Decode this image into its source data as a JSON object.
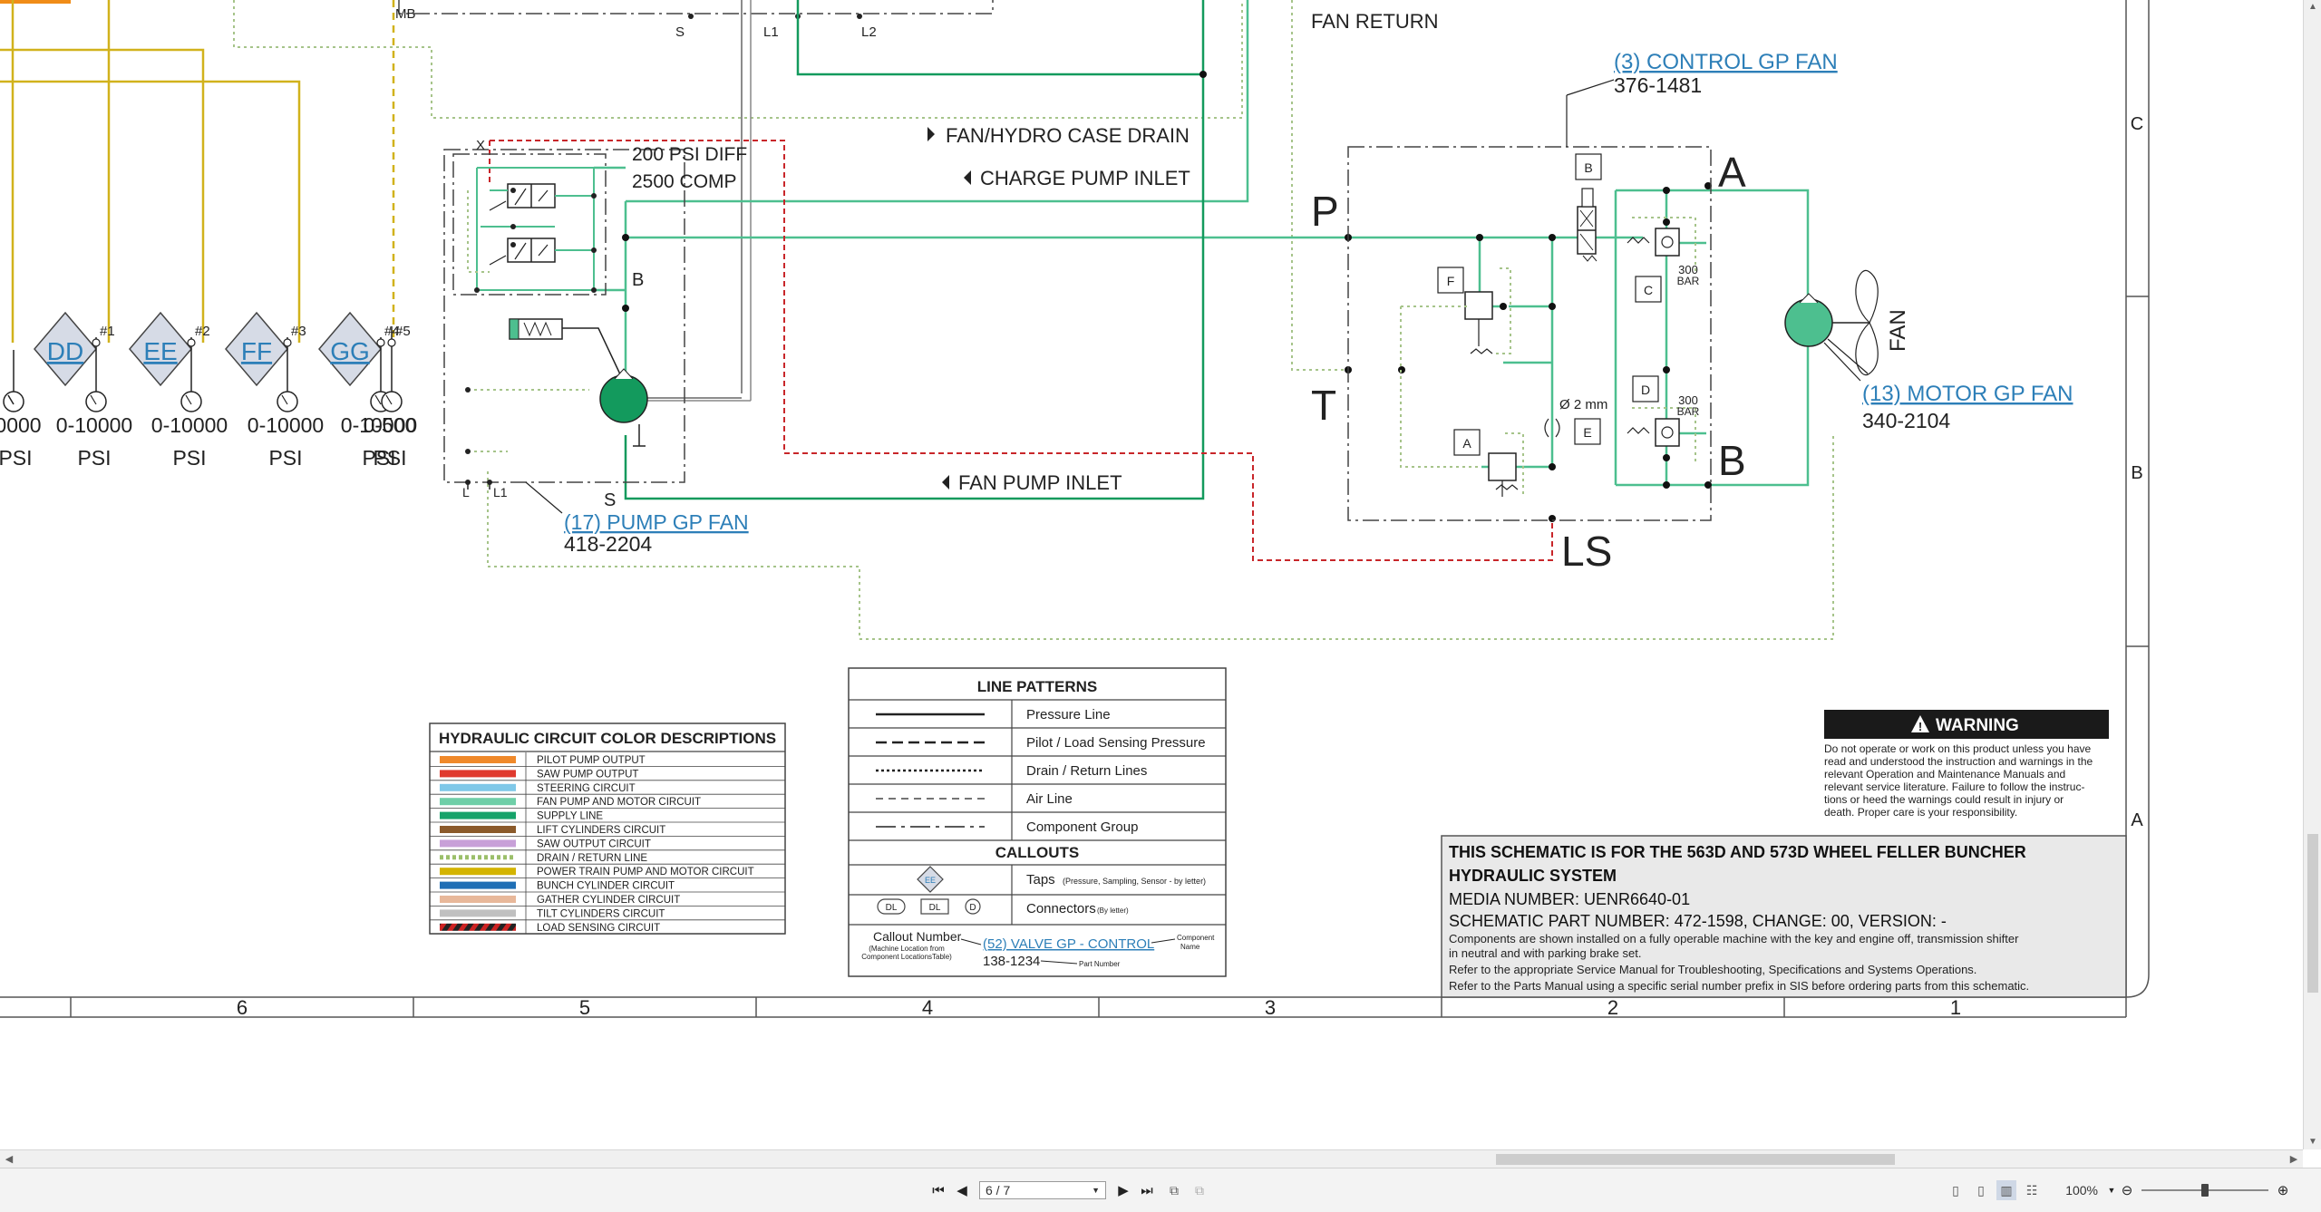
{
  "schematic": {
    "labels": {
      "mb": "MB",
      "s_top": "S",
      "l1_top": "L1",
      "l2_top": "L2",
      "fan_return": "FAN RETURN",
      "control_gp_fan": "(3) CONTROL GP FAN",
      "control_pn": "376-1481",
      "fan_hydro_case_drain": "FAN/HYDRO CASE DRAIN",
      "charge_pump_inlet": "CHARGE PUMP INLET",
      "fan_pump_inlet": "FAN PUMP INLET",
      "psi_diff": "200 PSI DIFF",
      "comp": "2500 COMP",
      "port_x": "X",
      "port_b_pump": "B",
      "port_s_pump": "S",
      "port_l": "L",
      "port_l1": "L1",
      "pump_gp_fan": "(17) PUMP GP FAN",
      "pump_pn": "418-2204",
      "port_p": "P",
      "port_t": "T",
      "port_a": "A",
      "port_b": "B",
      "port_ls": "LS",
      "box_b": "B",
      "box_c": "C",
      "box_d": "D",
      "box_e": "E",
      "box_f": "F",
      "box_a": "A",
      "bar_300_a": "300",
      "bar_label_a": "BAR",
      "bar_300_b": "300",
      "bar_label_b": "BAR",
      "orifice": "Ø 2 mm",
      "fan": "FAN",
      "motor_gp_fan": "(13) MOTOR GP FAN",
      "motor_pn": "340-2104",
      "grid_c": "C",
      "grid_b": "B",
      "grid_a": "A"
    },
    "taps": [
      {
        "id": "DD",
        "num": "#1",
        "range": "0-10000",
        "unit": "PSI"
      },
      {
        "id": "EE",
        "num": "#2",
        "range": "0-10000",
        "unit": "PSI"
      },
      {
        "id": "FF",
        "num": "#3",
        "range": "0-10000",
        "unit": "PSI"
      },
      {
        "id": "GG",
        "num": "#4",
        "range": "0-10000",
        "unit": "PSI"
      },
      {
        "id": "",
        "num": "#5",
        "range": "0-500",
        "unit": "PSI"
      }
    ],
    "partial_tap": {
      "range": "0000",
      "unit": "PSI"
    },
    "grid_numbers": [
      "6",
      "5",
      "4",
      "3",
      "2",
      "1"
    ],
    "color_legend": {
      "title": "HYDRAULIC CIRCUIT COLOR DESCRIPTIONS",
      "items": [
        {
          "label": "PILOT PUMP OUTPUT",
          "color": "#f0892a"
        },
        {
          "label": "SAW PUMP OUTPUT",
          "color": "#e03a2e"
        },
        {
          "label": "STEERING CIRCUIT",
          "color": "#7fc8e8"
        },
        {
          "label": "FAN PUMP AND MOTOR CIRCUIT",
          "color": "#6fcfa8"
        },
        {
          "label": "SUPPLY LINE",
          "color": "#16a36a"
        },
        {
          "label": "LIFT CYLINDERS CIRCUIT",
          "color": "#8b5a2b"
        },
        {
          "label": "SAW OUTPUT CIRCUIT",
          "color": "#c8a0d8"
        },
        {
          "label": "DRAIN / RETURN LINE",
          "color": "#9bbf6a"
        },
        {
          "label": "POWER TRAIN PUMP AND MOTOR CIRCUIT",
          "color": "#d4b400"
        },
        {
          "label": "BUNCH CYLINDER CIRCUIT",
          "color": "#1f6fb5"
        },
        {
          "label": "GATHER CYLINDER CIRCUIT",
          "color": "#e8b89a"
        },
        {
          "label": "TILT CYLINDERS CIRCUIT",
          "color": "#c0c0c0"
        },
        {
          "label": "LOAD SENSING CIRCUIT",
          "color": "#cc2222"
        }
      ]
    },
    "line_patterns": {
      "title": "LINE PATTERNS",
      "items": [
        "Pressure Line",
        "Pilot / Load Sensing Pressure",
        "Drain / Return Lines",
        "Air Line",
        "Component Group"
      ],
      "callouts_title": "CALLOUTS",
      "taps_label": "Taps",
      "taps_sub": "(Pressure, Sampling, Sensor - by letter)",
      "connectors_label": "Connectors",
      "connectors_sub": "(By letter)",
      "conn_dl_1": "DL",
      "conn_dl_2": "DL",
      "conn_d": "D",
      "tap_sym": "EE",
      "callout_number": "Callout Number",
      "callout_number_sub1": "(Machine Location from",
      "callout_number_sub2": "Component LocationsTable)",
      "callout_example": "(52) VALVE GP - CONTROL",
      "component_name_1": "Component",
      "component_name_2": "Name",
      "part_example": "138-1234",
      "part_number_label": "Part Number"
    },
    "warning": {
      "title": "WARNING",
      "lines": [
        "Do not operate or work on this product unless you have",
        "read and understood the instruction and warnings in the",
        "relevant Operation and Maintenance Manuals and",
        "relevant service literature. Failure to follow the instruc-",
        "tions or heed the warnings could result in injury or",
        "death. Proper care is your responsibility."
      ]
    },
    "title_block": {
      "line1": "THIS SCHEMATIC IS FOR THE 563D AND 573D WHEEL FELLER BUNCHER",
      "line2": "HYDRAULIC SYSTEM",
      "media": "MEDIA NUMBER: UENR6640-01",
      "part": "SCHEMATIC PART NUMBER: 472-1598, CHANGE: 00, VERSION: -",
      "note1": "Components are shown installed on a fully operable machine with the key and engine off, transmission shifter",
      "note2": "in neutral and with parking brake set.",
      "note3": "Refer to the appropriate Service Manual for Troubleshooting, Specifications and Systems Operations.",
      "note4": "Refer to the Parts Manual using a specific serial number prefix in SIS before ordering parts from this schematic."
    }
  },
  "viewer": {
    "page_display": "6 / 7",
    "zoom": "100%"
  },
  "colors": {
    "fan_green": "#4dbf8f",
    "supply_green": "#139a5d",
    "drain": "#a6c48a",
    "ls_red": "#c8262a",
    "yellow": "#d1b21c",
    "link_blue": "#2d7fb8",
    "tap_fill": "#d6dbe6"
  }
}
